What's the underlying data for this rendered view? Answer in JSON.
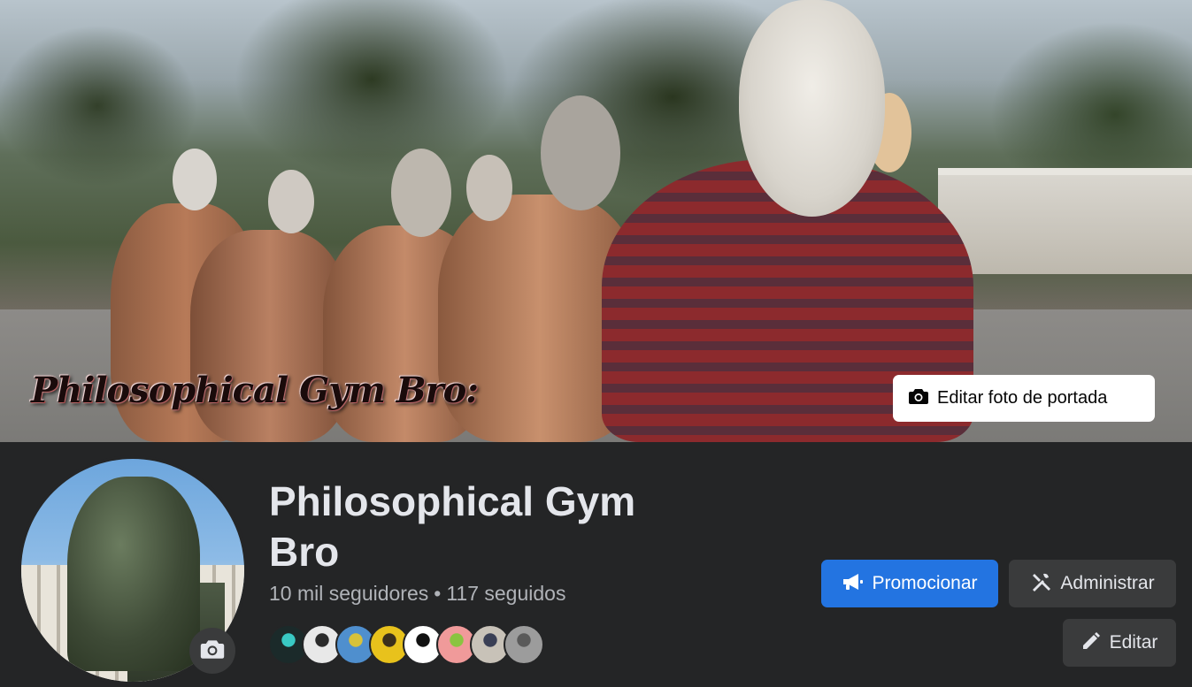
{
  "cover": {
    "overlay_text": "Philosophical Gym Bro:",
    "edit_button_label": "Editar foto de portada",
    "edit_button_icon": "camera-icon"
  },
  "profile": {
    "name": "Philosophical Gym Bro",
    "followers": "10 mil seguidores",
    "separator": "•",
    "following": "117 seguidos",
    "avatar_camera_icon": "camera-icon"
  },
  "followers_preview": [
    {
      "name": "follower-avatar-1",
      "color": "#1b2a2a",
      "accent": "#39c9c4"
    },
    {
      "name": "follower-avatar-2",
      "color": "#e8e8e8",
      "accent": "#2a2a2a"
    },
    {
      "name": "follower-avatar-3",
      "color": "#4f8fce",
      "accent": "#d8c23a"
    },
    {
      "name": "follower-avatar-4",
      "color": "#e8c21c",
      "accent": "#3a2f1c"
    },
    {
      "name": "follower-avatar-5",
      "color": "#ffffff",
      "accent": "#111111"
    },
    {
      "name": "follower-avatar-6",
      "color": "#f09a9a",
      "accent": "#8ac440"
    },
    {
      "name": "follower-avatar-7",
      "color": "#c8c2b8",
      "accent": "#3a3f55"
    },
    {
      "name": "follower-avatar-8",
      "color": "#9c9c9c",
      "accent": "#5a5a5a"
    }
  ],
  "actions": {
    "promote_label": "Promocionar",
    "promote_icon": "megaphone-icon",
    "manage_label": "Administrar",
    "manage_icon": "tools-icon",
    "edit_label": "Editar",
    "edit_icon": "pencil-icon"
  },
  "colors": {
    "background": "#242526",
    "primary_button": "#2374e1",
    "secondary_button": "#3a3b3c",
    "text_primary": "#e4e6eb",
    "text_secondary": "#b0b3b8"
  }
}
